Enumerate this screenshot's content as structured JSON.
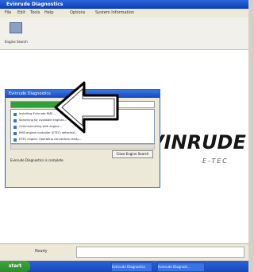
{
  "window": {
    "title": "Evinrude Diagnostics"
  },
  "menu": [
    "File",
    "Edit",
    "Tools",
    "Help",
    "Options",
    "System Information"
  ],
  "toolbar": {
    "button_label": "Engine Search"
  },
  "brand": {
    "name": "VINRUDE",
    "subtitle": "E-TEC"
  },
  "dialog": {
    "title": "Evinrude Diagnostics",
    "progress": 0.36,
    "log": [
      "Installing Evinrude RMS...",
      "Searching for available engines...",
      "Communicating with engine...",
      "RMS engine controller (ETEC) detected...",
      "ETEC engine: Operating connection ready..."
    ],
    "button": "Close Engine Search",
    "status": "Evinrude Diagnostics is complete."
  },
  "statusbar": {
    "label": "Ready"
  },
  "taskbar": {
    "start": "start",
    "tasks": [
      "Evinrude Diagnostics",
      "Evinrude Diagnost..."
    ]
  }
}
